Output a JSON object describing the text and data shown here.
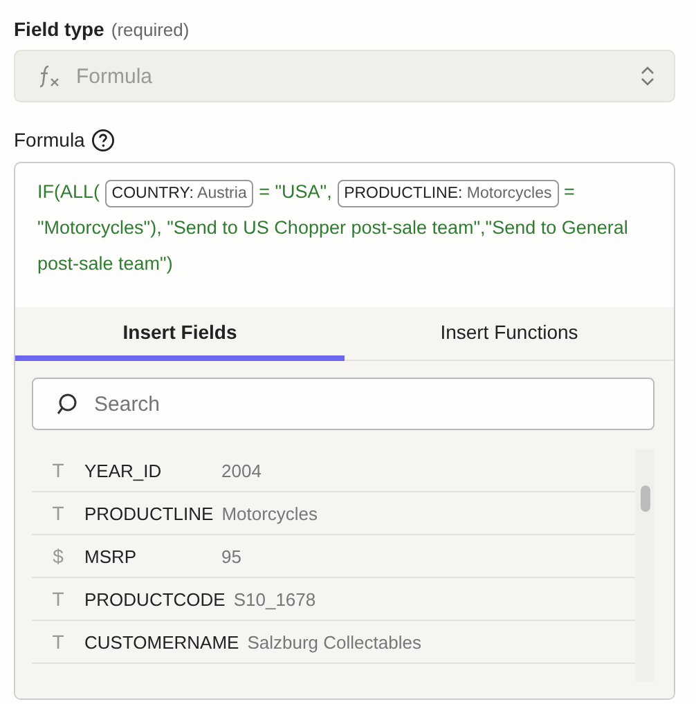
{
  "field_type": {
    "label": "Field type",
    "hint": "(required)",
    "value": "Formula",
    "disabled": true
  },
  "formula": {
    "label": "Formula",
    "segments": [
      {
        "kind": "text",
        "text": "IF(ALL( "
      },
      {
        "kind": "token",
        "name": "COUNTRY:",
        "value": "Austria"
      },
      {
        "kind": "text",
        "text": " = \"USA\", "
      },
      {
        "kind": "token",
        "name": "PRODUCTLINE:",
        "value": "Motorcycles"
      },
      {
        "kind": "text",
        "text": " = \"Motorcycles\"), \"Send to US Chopper post-sale team\",\"Send to General post-sale team\")"
      }
    ]
  },
  "tabs": [
    {
      "label": "Insert Fields",
      "selected": true
    },
    {
      "label": "Insert Functions",
      "selected": false
    }
  ],
  "search": {
    "placeholder": "Search"
  },
  "fields": [
    {
      "icon": "T",
      "name": "YEAR_ID",
      "value": "2004"
    },
    {
      "icon": "T",
      "name": "PRODUCTLINE",
      "value": "Motorcycles"
    },
    {
      "icon": "$",
      "name": "MSRP",
      "value": "95"
    },
    {
      "icon": "T",
      "name": "PRODUCTCODE",
      "value": "S10_1678"
    },
    {
      "icon": "T",
      "name": "CUSTOMERNAME",
      "value": "Salzburg Collectables"
    }
  ]
}
